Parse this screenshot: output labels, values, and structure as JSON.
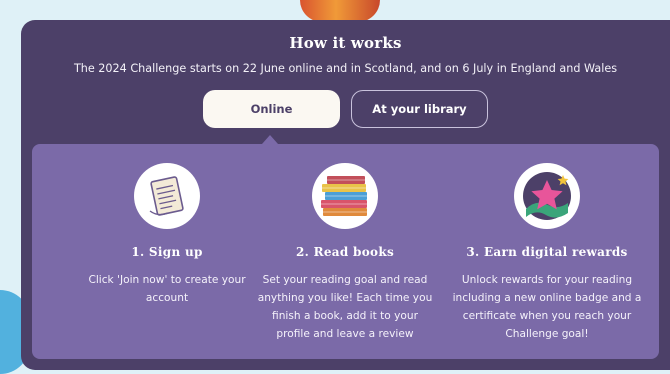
{
  "header": {
    "title": "How it works",
    "subtitle": "The 2024 Challenge starts on 22 June online and in Scotland, and on 6 July in England and Wales"
  },
  "tabs": [
    {
      "label": "Online",
      "selected": true
    },
    {
      "label": "At your library",
      "selected": false
    }
  ],
  "steps": [
    {
      "icon": "paper-scroll-icon",
      "title": "1. Sign up",
      "description": "Click 'Join now' to create your account"
    },
    {
      "icon": "book-stack-icon",
      "title": "2. Read books",
      "description": "Set your reading goal and read anything you like! Each time you finish a book, add it to your profile and leave a review"
    },
    {
      "icon": "star-badge-icon",
      "title": "3. Earn digital rewards",
      "description": "Unlock rewards for your reading including a new online badge and a certificate when you reach your Challenge goal!"
    }
  ],
  "colors": {
    "panel": "#4c4068",
    "inner_panel": "#7b6aa8",
    "selected_tab": "#fbf8f2",
    "page_background": "#dff1f7"
  }
}
